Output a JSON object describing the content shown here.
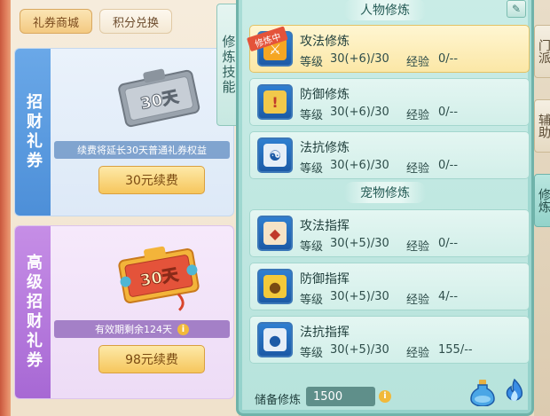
{
  "shop": {
    "tabs": [
      {
        "label": "礼券商城",
        "active": true
      },
      {
        "label": "积分兑换",
        "active": false
      }
    ],
    "cards": [
      {
        "label": "招财礼券",
        "ticket_text": "30天",
        "note": "续费将延长30天普通礼券权益",
        "button": "30元续费"
      },
      {
        "label": "高级招财礼券",
        "ticket_text": "30天",
        "note": "有效期剩余124天",
        "button": "98元续费"
      }
    ]
  },
  "skill_tab": {
    "label": "修炼技能"
  },
  "panel": {
    "person_title": "人物修炼",
    "pet_title": "宠物修炼",
    "training_badge": "修炼中",
    "level_label": "等级",
    "exp_label": "经验",
    "person_skills": [
      {
        "name": "攻法修炼",
        "level": "30(+6)/30",
        "exp": "0/--",
        "selected": true,
        "icon": "sword-icon"
      },
      {
        "name": "防御修炼",
        "level": "30(+6)/30",
        "exp": "0/--",
        "selected": false,
        "icon": "shield-icon"
      },
      {
        "name": "法抗修炼",
        "level": "30(+6)/30",
        "exp": "0/--",
        "selected": false,
        "icon": "yin-yang-icon"
      }
    ],
    "pet_skills": [
      {
        "name": "攻法指挥",
        "level": "30(+5)/30",
        "exp": "0/--",
        "icon": "paw-attack-icon"
      },
      {
        "name": "防御指挥",
        "level": "30(+5)/30",
        "exp": "4/--",
        "icon": "paw-shield-icon"
      },
      {
        "name": "法抗指挥",
        "level": "30(+5)/30",
        "exp": "155/--",
        "icon": "paw-resist-icon"
      }
    ],
    "reserve": {
      "label": "储备修炼",
      "value": "1500"
    }
  },
  "side_tabs": [
    {
      "label": "门派",
      "active": false
    },
    {
      "label": "辅助",
      "active": false
    },
    {
      "label": "修炼",
      "active": true
    }
  ],
  "colors": {
    "panel_bg": "#b7e3dc",
    "selected_row": "#fbe7a6",
    "button_gold": "#f6c65c",
    "badge_red": "#e4533a"
  }
}
